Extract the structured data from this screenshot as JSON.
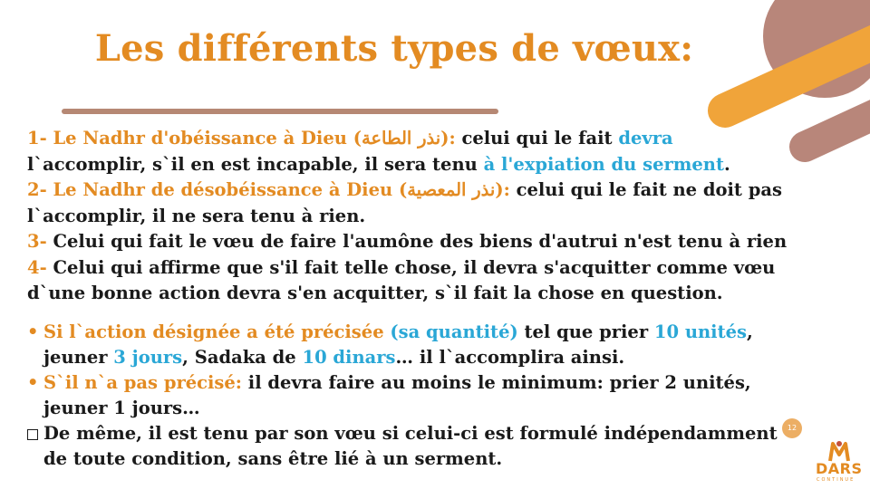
{
  "title": "Les différents types de vœux:",
  "colors": {
    "accent": "#e38b22",
    "highlight": "#2aa7d6",
    "rule": "#b68874"
  },
  "items": {
    "one": {
      "num": "1-",
      "head": " Le Nadhr d'obéissance à Dieu (",
      "arabic": "نذر الطاعة",
      "close": "):",
      "t1": " celui qui le fait ",
      "hl1": "devra",
      "t2": "l`accomplir, s`il en est incapable, il sera tenu ",
      "hl2": "à l'expiation du serment",
      "end": "."
    },
    "two": {
      "num": "2-",
      "head": " Le Nadhr de désobéissance à Dieu (",
      "arabic": "نذر المعصية",
      "close": "):",
      "t1": " celui qui le fait ne doit pas",
      "t2": "l`accomplir, il ne sera tenu à rien."
    },
    "three": {
      "num": "3-",
      "text": " Celui qui fait le vœu de faire l'aumône des biens d'autrui n'est tenu à rien"
    },
    "four": {
      "num": "4-",
      "t1": " Celui qui affirme que s'il fait telle chose, il devra s'acquitter comme vœu",
      "t2": "d`une bonne action devra s'en acquitter, s`il fait la chose en question."
    }
  },
  "bullets": {
    "b1": {
      "lead": "Si l`action désignée a été précisée ",
      "paren": "(sa quantité)",
      "t1": " tel que prier ",
      "v1": "10 unités",
      "t1b": ",",
      "t2": "jeuner ",
      "v2": "3 jours",
      "t3": ",  Sadaka de ",
      "v3": "10 dinars",
      "t4": "… il l`accomplira ainsi."
    },
    "b2": {
      "lead": "S`il n`a pas précisé:",
      "t1": " il devra faire au moins le minimum: prier 2 unités,",
      "t2": "jeuner 1 jours…"
    },
    "b3": {
      "t1": "De même, il est tenu par son vœu si celui-ci est formulé indépendamment",
      "t2": "de toute condition, sans être lié à un serment."
    }
  },
  "footer": {
    "page_number": "12",
    "logo_text": "DARS",
    "logo_sub": "CONTINUE"
  }
}
